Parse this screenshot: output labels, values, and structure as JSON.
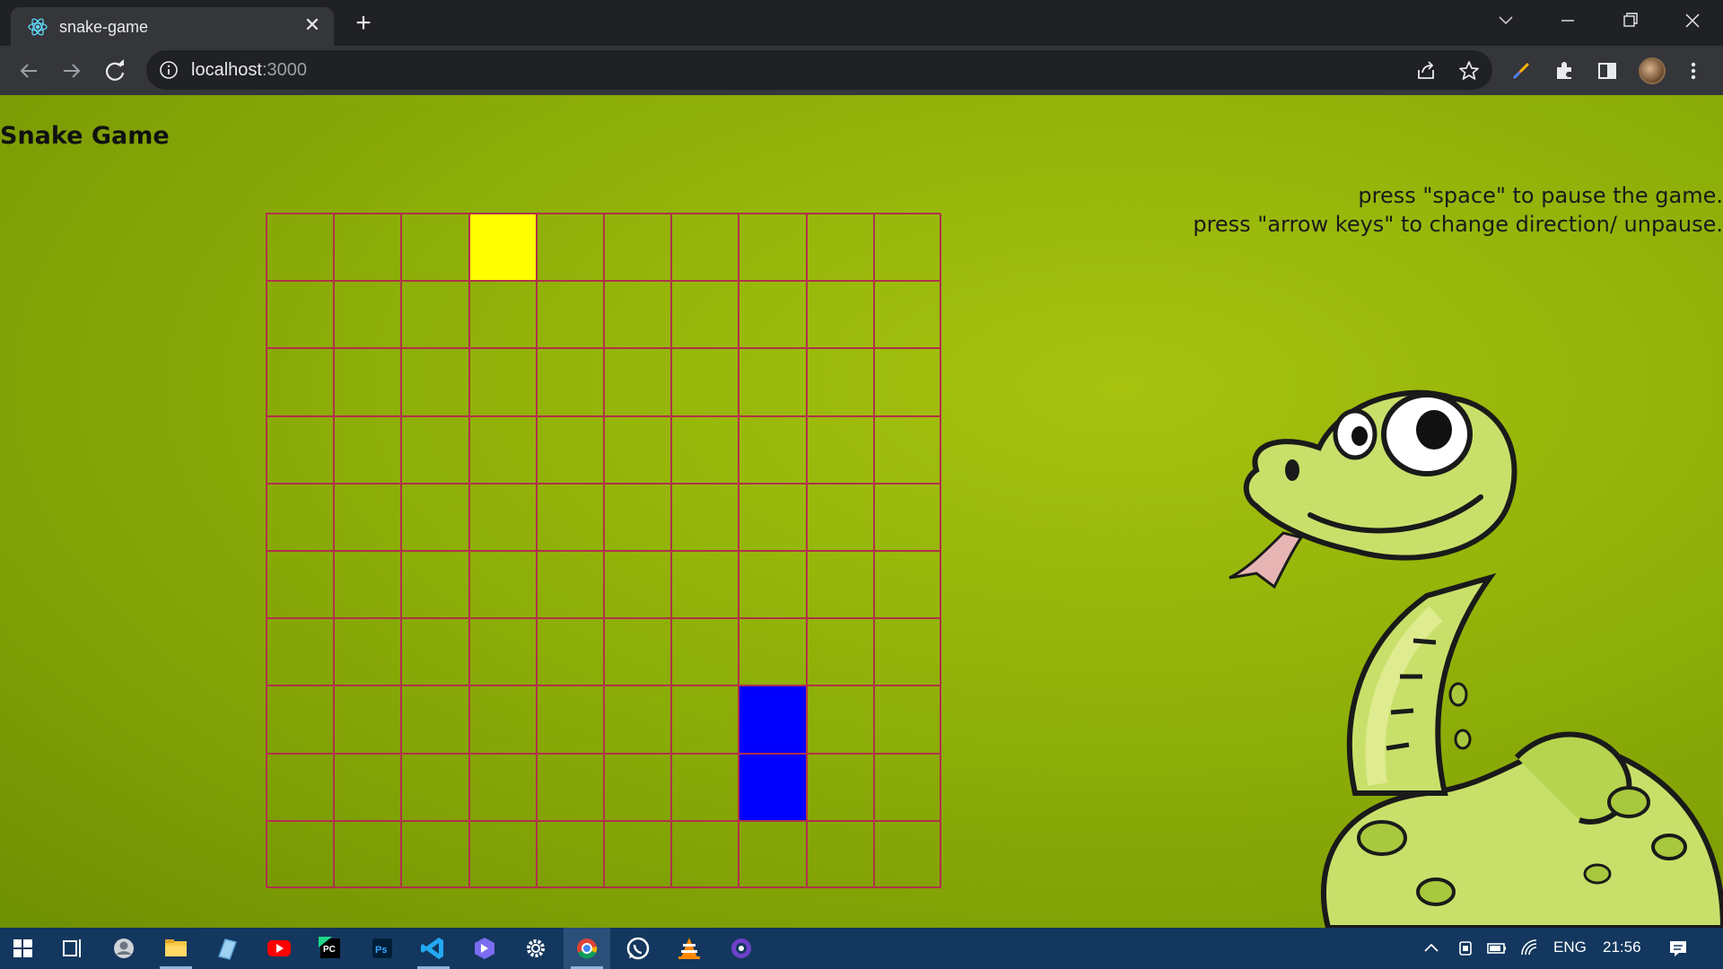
{
  "browser": {
    "tab_title": "snake-game",
    "url_host": "localhost",
    "url_port": ":3000"
  },
  "page": {
    "title": "Snake Game",
    "instructions": [
      "press \"space\" to pause the game.",
      "press \"arrow keys\" to change direction/ unpause."
    ]
  },
  "game": {
    "grid_rows": 10,
    "grid_cols": 10,
    "food": [
      {
        "row": 0,
        "col": 3
      }
    ],
    "snake": [
      {
        "row": 7,
        "col": 7
      },
      {
        "row": 8,
        "col": 7
      }
    ],
    "colors": {
      "food": "#ffff00",
      "snake": "#0000ff",
      "grid_line": "#b0324a",
      "background": "#94b40a"
    }
  },
  "taskbar": {
    "language": "ENG",
    "time": "21:56",
    "apps": [
      "start-icon",
      "task-view-icon",
      "people-icon",
      "file-explorer-icon",
      "notes-icon",
      "youtube-icon",
      "pycharm-icon",
      "photoshop-icon",
      "vscode-icon",
      "app-icon",
      "settings-icon",
      "chrome-icon",
      "whatsapp-icon",
      "vlc-icon",
      "github-icon"
    ]
  }
}
